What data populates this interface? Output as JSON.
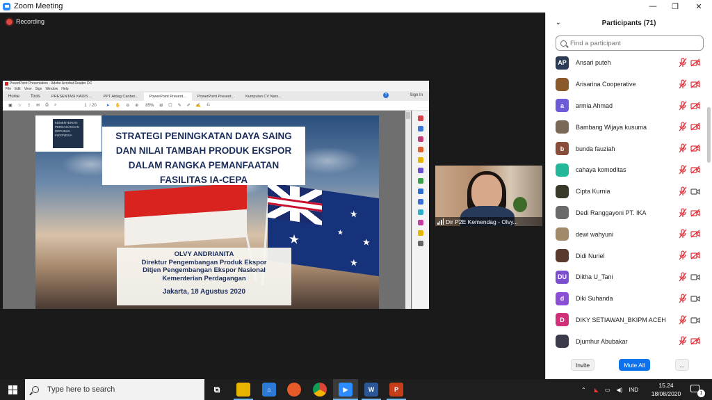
{
  "window": {
    "title": "Zoom Meeting",
    "minimize": "—",
    "maximize": "❐",
    "close": "✕"
  },
  "recording": {
    "label": "Recording"
  },
  "acrobat": {
    "title": "PowerPoint Presentation - Adobe Acrobat Reader DC",
    "menu": [
      "File",
      "Edit",
      "View",
      "Sign",
      "Window",
      "Help"
    ],
    "tabs": [
      "Home",
      "Tools",
      "PRESENTASI KADIS ...",
      "PPT Atdag Canber...",
      "PowerPoint Present...",
      "PowerPoint Present...",
      "Kumpulan CV Nars..."
    ],
    "sign_in": "Sign In",
    "page": "1",
    "page_total": "/ 20",
    "zoom": "85%"
  },
  "slide": {
    "title_lines": [
      "STRATEGI PENINGKATAN DAYA SAING",
      "DAN NILAI TAMBAH PRODUK EKSPOR",
      "DALAM RANGKA PEMANFAATAN",
      "FASILITAS IA-CEPA"
    ],
    "logo_text": "KEMENTERIAN PERDAGANGAN REPUBLIK INDONESIA",
    "presenter": "OLVY ANDRIANITA",
    "role_lines": [
      "Direktur Pengembangan Produk Ekspor",
      "Ditjen Pengembangan Ekspor Nasional",
      "Kementerian Perdagangan"
    ],
    "date": "Jakarta, 18 Agustus 2020"
  },
  "video": {
    "caption": "Dir P2E Kemendag - Olvy..."
  },
  "participants": {
    "header": "Participants (71)",
    "search_placeholder": "Find a participant",
    "list": [
      {
        "name": "Ansari puteh",
        "initials": "AP",
        "color": "#2b3a55",
        "cam": "off"
      },
      {
        "name": "Arisarina Cooperative",
        "initials": "",
        "color": "#8a5a2a",
        "cam": "off"
      },
      {
        "name": "armia Ahmad",
        "initials": "a",
        "color": "#6b5bd6",
        "cam": "off"
      },
      {
        "name": "Bambang Wijaya kusuma",
        "initials": "",
        "color": "#7a6a55",
        "cam": "off"
      },
      {
        "name": "bunda fauziah",
        "initials": "b",
        "color": "#8a4d3a",
        "cam": "off"
      },
      {
        "name": "cahaya komoditas",
        "initials": "",
        "color": "#23b89a",
        "cam": "off"
      },
      {
        "name": "Cipta Kurnia",
        "initials": "",
        "color": "#3a3a2a",
        "cam": "on"
      },
      {
        "name": "Dedi Ranggayoni PT. IKA",
        "initials": "",
        "color": "#6a6a6a",
        "cam": "off"
      },
      {
        "name": "dewi wahyuni",
        "initials": "",
        "color": "#a08a6a",
        "cam": "off"
      },
      {
        "name": "Didi Nuriel",
        "initials": "",
        "color": "#5a3a2a",
        "cam": "off"
      },
      {
        "name": "Diitha U_Tani",
        "initials": "DU",
        "color": "#7b4fd0",
        "cam": "on"
      },
      {
        "name": "Diki Suhanda",
        "initials": "d",
        "color": "#8a4fd6",
        "cam": "on"
      },
      {
        "name": "DIKY SETIAWAN_BKIPM ACEH",
        "initials": "D",
        "color": "#d0307a",
        "cam": "on"
      },
      {
        "name": "Djumhur Abubakar",
        "initials": "",
        "color": "#3a3a4a",
        "cam": "off"
      }
    ],
    "invite": "Invite",
    "mute_all": "Mute All",
    "more": "..."
  },
  "taskbar": {
    "search_placeholder": "Type here to search",
    "lang": "IND",
    "time": "15.24",
    "date": "18/08/2020",
    "notif_count": "1"
  }
}
